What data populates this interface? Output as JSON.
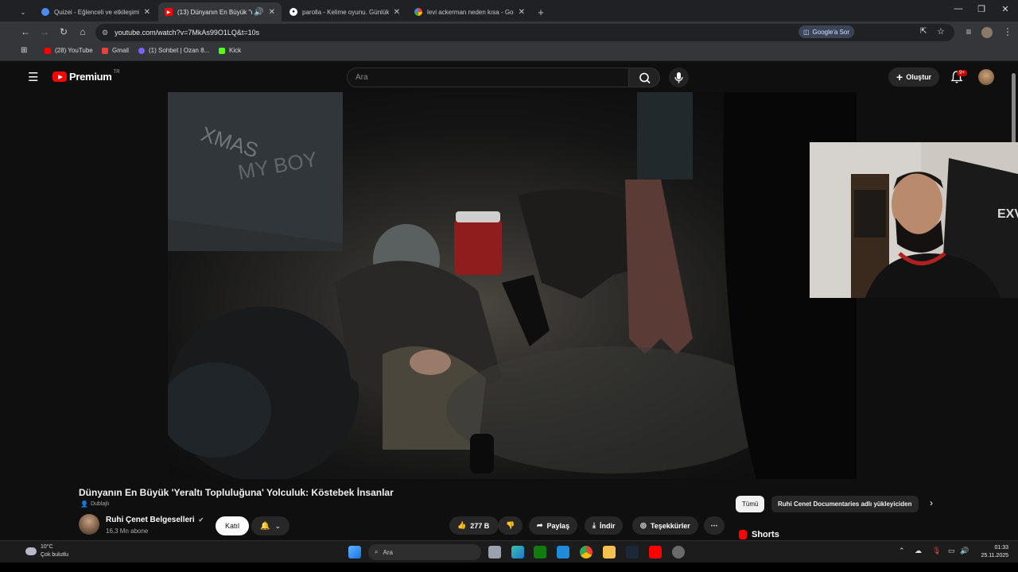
{
  "browser": {
    "tabs": [
      {
        "title": "Quizei - Eğlenceli ve etkileşimli",
        "favicon": "quiz-icon",
        "active": false
      },
      {
        "title": "(13) Dünyanın En Büyük 'Ye",
        "favicon": "youtube-icon",
        "active": true
      },
      {
        "title": "parolla - Kelime oyunu. Günlük",
        "favicon": "parolla-icon",
        "active": false
      },
      {
        "title": "levi ackerman neden kısa - Goo",
        "favicon": "google-icon",
        "active": false
      }
    ],
    "new_tab": "+",
    "url": "youtube.com/watch?v=7MkAs99O1LQ&t=10s",
    "ask_google": "Google'a Sor",
    "bookmarks": [
      {
        "label": "(28) YouTube",
        "color": "#ff0000"
      },
      {
        "label": "Gmail",
        "color": "#ea4335"
      },
      {
        "label": "(1) Sohbet | Ozan 8...",
        "color": "#7b61ff"
      },
      {
        "label": "Kick",
        "color": "#53fc18"
      }
    ]
  },
  "youtube": {
    "logo_text": "Premium",
    "logo_region": "TR",
    "search_placeholder": "Ara",
    "create_label": "Oluştur",
    "notification_badge": "9+",
    "video_title": "Dünyanın En Büyük 'Yeraltı Topluluğuna' Yolculuk: Köstebek İnsanlar",
    "dubbed_label": "Dublajlı",
    "channel_name": "Ruhi Çenet Belgeselleri",
    "subscribers": "16,3 Mn abone",
    "join_label": "Katıl",
    "likes": "277 B",
    "share_label": "Paylaş",
    "download_label": "İndir",
    "thanks_label": "Teşekkürler",
    "chip_all": "Tümü",
    "chip_channel": "Ruhi Cenet Documentaries adlı yükleyiciden",
    "shorts_label": "Shorts"
  },
  "taskbar": {
    "temperature": "10°C",
    "weather_desc": "Çok bulutlu",
    "search_placeholder": "Ara",
    "time": "01:33",
    "date": "25.11.2025"
  }
}
